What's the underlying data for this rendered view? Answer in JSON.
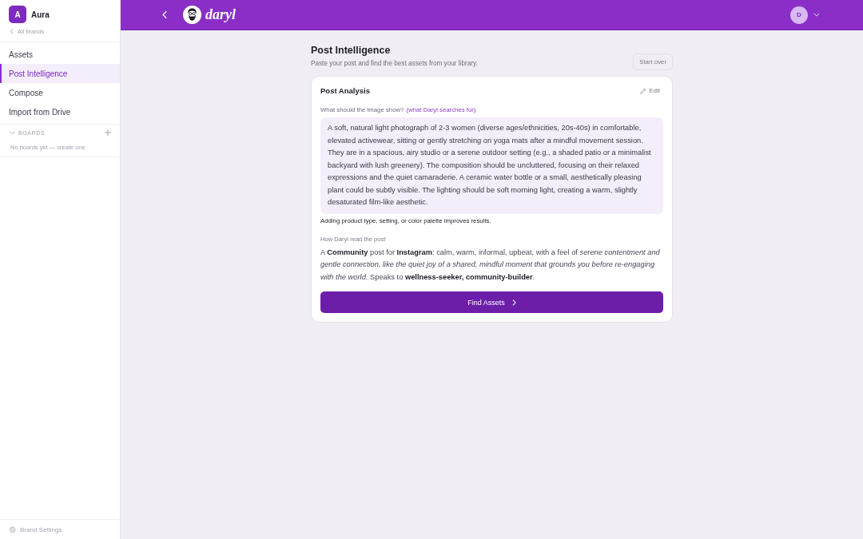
{
  "sidebar": {
    "brand": {
      "initial": "A",
      "name": "Aura"
    },
    "back_link": "All brands",
    "nav_items": [
      {
        "label": "Assets",
        "selected": false
      },
      {
        "label": "Post Intelligence",
        "selected": true
      },
      {
        "label": "Compose",
        "selected": false
      },
      {
        "label": "Import from Drive",
        "selected": false
      }
    ],
    "boards": {
      "title": "BOARDS",
      "expanded": true,
      "empty_text": "No boards yet — create one"
    },
    "footer_link": "Brand Settings"
  },
  "topbar": {
    "logo_text": "daryl",
    "user_initial": "D"
  },
  "page": {
    "title": "Post Intelligence",
    "subtitle": "Paste your post and find the best assets from your library.",
    "start_over": "Start over"
  },
  "card": {
    "title": "Post Analysis",
    "edit": "Edit",
    "image_prompt": {
      "label": "What should the image show?",
      "hint": "(what Daryl searches for)",
      "value": "A soft, natural light photograph of 2-3 women (diverse ages/ethnicities, 20s-40s) in comfortable, elevated activewear, sitting or gently stretching on yoga mats after a mindful movement session. They are in a spacious, airy studio or a serene outdoor setting (e.g., a shaded patio or a minimalist backyard with lush greenery). The composition should be uncluttered, focusing on their relaxed expressions and the quiet camaraderie. A ceramic water bottle or a small, aesthetically pleasing plant could be subtly visible. The lighting should be soft morning light, creating a warm, slightly desaturated film-like aesthetic.",
      "tip": "Adding product type, setting, or color palette improves results."
    },
    "reading": {
      "label": "How Daryl read the post",
      "text": "A **Community** post for **Instagram**: calm, warm, informal, upbeat, with a feel of *serene contentment and gentle connection, like the quiet joy of a shared, mindful moment that grounds you before re-engaging with the world*. Speaks to **wellness-seeker, community-builder**."
    },
    "button": "Find Assets"
  }
}
